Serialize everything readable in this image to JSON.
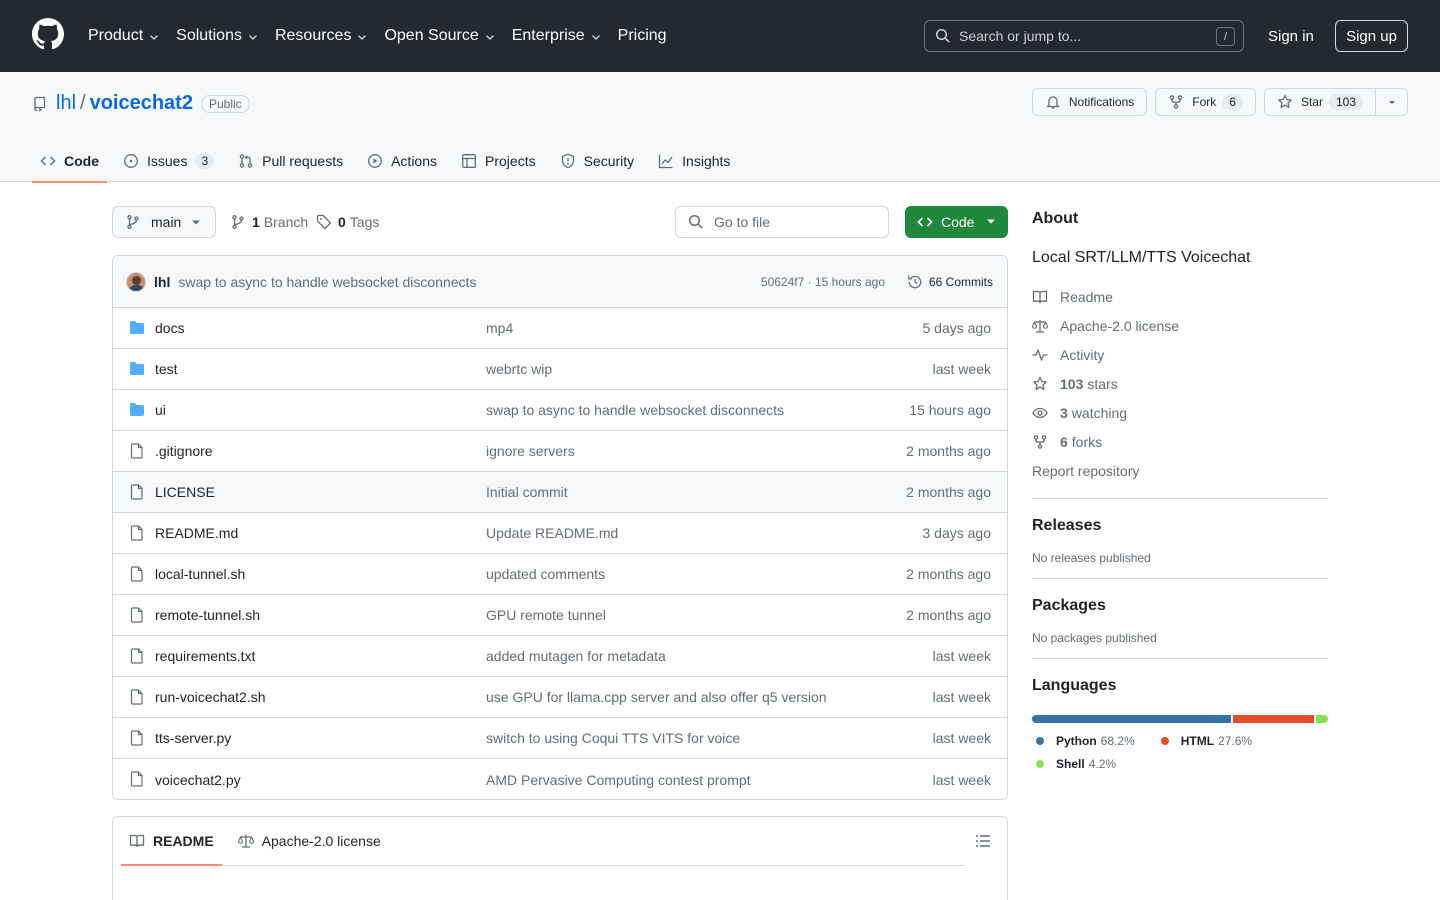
{
  "header": {
    "nav": [
      {
        "label": "Product",
        "dropdown": true
      },
      {
        "label": "Solutions",
        "dropdown": true
      },
      {
        "label": "Resources",
        "dropdown": true
      },
      {
        "label": "Open Source",
        "dropdown": true
      },
      {
        "label": "Enterprise",
        "dropdown": true
      },
      {
        "label": "Pricing",
        "dropdown": false
      }
    ],
    "search_placeholder": "Search or jump to...",
    "search_shortcut": "/",
    "sign_in": "Sign in",
    "sign_up": "Sign up"
  },
  "repo": {
    "owner": "lhl",
    "separator": "/",
    "name": "voicechat2",
    "visibility": "Public",
    "notifications_label": "Notifications",
    "fork_label": "Fork",
    "fork_count": "6",
    "star_label": "Star",
    "star_count": "103",
    "tabs": [
      {
        "label": "Code",
        "icon": "code-icon",
        "counter": "",
        "active": true
      },
      {
        "label": "Issues",
        "icon": "issue-icon",
        "counter": "3",
        "active": false
      },
      {
        "label": "Pull requests",
        "icon": "pull-request-icon",
        "counter": "",
        "active": false
      },
      {
        "label": "Actions",
        "icon": "play-icon",
        "counter": "",
        "active": false
      },
      {
        "label": "Projects",
        "icon": "table-icon",
        "counter": "",
        "active": false
      },
      {
        "label": "Security",
        "icon": "shield-icon",
        "counter": "",
        "active": false
      },
      {
        "label": "Insights",
        "icon": "graph-icon",
        "counter": "",
        "active": false
      }
    ]
  },
  "toolbar": {
    "branch": "main",
    "branch_count": "1",
    "branch_label": "Branch",
    "tag_count": "0",
    "tag_label": "Tags",
    "goto_placeholder": "Go to file",
    "code_label": "Code"
  },
  "latest_commit": {
    "author": "lhl",
    "message": "swap to async to handle websocket disconnects",
    "meta": "50624f7 · 15 hours ago",
    "commits": "66 Commits"
  },
  "files": [
    {
      "name": "docs",
      "type": "dir",
      "message": "mp4",
      "date": "5 days ago"
    },
    {
      "name": "test",
      "type": "dir",
      "message": "webrtc wip",
      "date": "last week"
    },
    {
      "name": "ui",
      "type": "dir",
      "message": "swap to async to handle websocket disconnects",
      "date": "15 hours ago"
    },
    {
      "name": ".gitignore",
      "type": "file",
      "message": "ignore servers",
      "date": "2 months ago"
    },
    {
      "name": "LICENSE",
      "type": "file",
      "message": "Initial commit",
      "date": "2 months ago"
    },
    {
      "name": "README.md",
      "type": "file",
      "message": "Update README.md",
      "date": "3 days ago"
    },
    {
      "name": "local-tunnel.sh",
      "type": "file",
      "message": "updated comments",
      "date": "2 months ago"
    },
    {
      "name": "remote-tunnel.sh",
      "type": "file",
      "message": "GPU remote tunnel",
      "date": "2 months ago"
    },
    {
      "name": "requirements.txt",
      "type": "file",
      "message": "added mutagen for metadata",
      "date": "last week"
    },
    {
      "name": "run-voicechat2.sh",
      "type": "file",
      "message": "use GPU for llama.cpp server and also offer q5 version",
      "date": "last week"
    },
    {
      "name": "tts-server.py",
      "type": "file",
      "message": "switch to using Coqui TTS VITS for voice",
      "date": "last week"
    },
    {
      "name": "voicechat2.py",
      "type": "file",
      "message": "AMD Pervasive Computing contest prompt",
      "date": "last week"
    }
  ],
  "readme_tabs": [
    {
      "label": "README",
      "icon": "book-icon",
      "active": true
    },
    {
      "label": "Apache-2.0 license",
      "icon": "law-icon",
      "active": false
    }
  ],
  "about": {
    "title": "About",
    "description": "Local SRT/LLM/TTS Voicechat",
    "readme": "Readme",
    "license": "Apache-2.0 license",
    "activity": "Activity",
    "stars_count": "103",
    "stars_label": "stars",
    "watching_count": "3",
    "watching_label": "watching",
    "forks_count": "6",
    "forks_label": "forks",
    "report": "Report repository"
  },
  "releases": {
    "title": "Releases",
    "note": "No releases published"
  },
  "packages": {
    "title": "Packages",
    "note": "No packages published"
  },
  "languages": {
    "title": "Languages",
    "items": [
      {
        "name": "Python",
        "percent_label": "68.2%",
        "percent": 68.2,
        "color": "#3572A5"
      },
      {
        "name": "HTML",
        "percent_label": "27.6%",
        "percent": 27.6,
        "color": "#e34c26"
      },
      {
        "name": "Shell",
        "percent_label": "4.2%",
        "percent": 4.2,
        "color": "#89e051"
      }
    ]
  }
}
